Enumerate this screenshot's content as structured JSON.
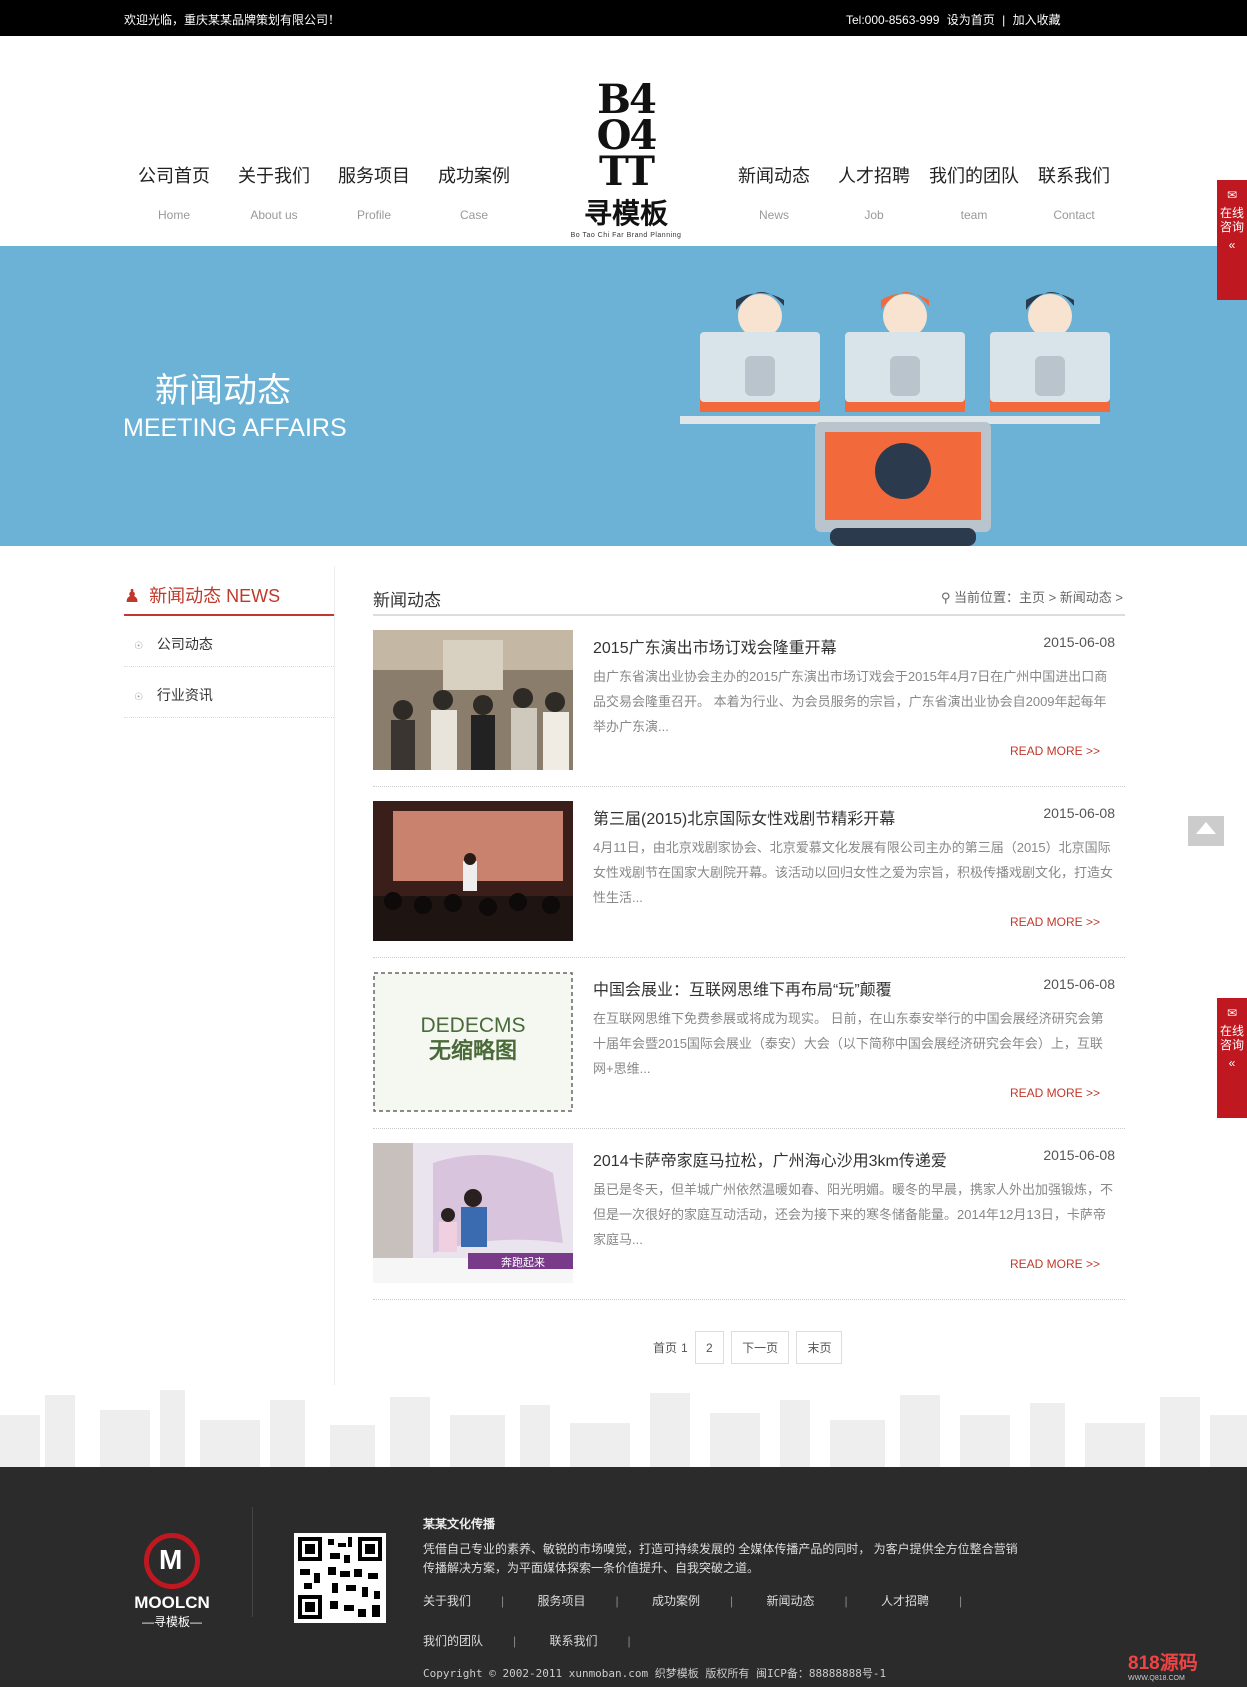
{
  "topbar": {
    "welcome": "欢迎光临，重庆某某品牌策划有限公司！",
    "tel": "Tel:000-8563-999",
    "set_home": "设为首页",
    "divider": "|",
    "favorite": "加入收藏"
  },
  "nav_left": [
    {
      "cn": "公司首页",
      "en": "Home"
    },
    {
      "cn": "关于我们",
      "en": "About us"
    },
    {
      "cn": "服务项目",
      "en": "Profile"
    },
    {
      "cn": "成功案例",
      "en": "Case"
    }
  ],
  "nav_right": [
    {
      "cn": "新闻动态",
      "en": "News"
    },
    {
      "cn": "人才招聘",
      "en": "Job"
    },
    {
      "cn": "我们的团队",
      "en": "team"
    },
    {
      "cn": "联系我们",
      "en": "Contact"
    }
  ],
  "logo": {
    "mark_line1": "B4",
    "mark_line2": "O4",
    "mark_line3": "TT",
    "name": "寻模板",
    "tagline": "Bo Tao Chi Far Brand Planning"
  },
  "banner": {
    "title_cn": "新闻动态",
    "title_en": "MEETING AFFAIRS",
    "bg_color": "#6bb2d6",
    "accent_color": "#f26a3b"
  },
  "side_float": {
    "label_top": "在线咨询",
    "label_bottom": "在线咨询",
    "arrow": "«"
  },
  "sidebar": {
    "title": "新闻动态 NEWS",
    "items": [
      "公司动态",
      "行业资讯"
    ]
  },
  "main": {
    "title": "新闻动态",
    "breadcrumb": "当前位置：主页 > 新闻动态 >"
  },
  "news": [
    {
      "title": "2015广东演出市场订戏会隆重开幕",
      "date": "2015-06-08",
      "desc": "由广东省演出业协会主办的2015广东演出市场订戏会于2015年4月7日在广州中国进出口商品交易会隆重召开。 本着为行业、为会员服务的宗旨，广东省演出业协会自2009年起每年举办广东演...",
      "more": "READ MORE >>"
    },
    {
      "title": "第三届(2015)北京国际女性戏剧节精彩开幕",
      "date": "2015-06-08",
      "desc": "4月11日，由北京戏剧家协会、北京爱慕文化发展有限公司主办的第三届（2015）北京国际女性戏剧节在国家大剧院开幕。该活动以回归女性之爱为宗旨，积极传播戏剧文化，打造女性生活...",
      "more": "READ MORE >>"
    },
    {
      "title": "中国会展业：互联网思维下再布局“玩”颠覆",
      "date": "2015-06-08",
      "desc": "在互联网思维下免费参展或将成为现实。 日前，在山东泰安举行的中国会展经济研究会第十届年会暨2015国际会展业（泰安）大会（以下简称中国会展经济研究会年会）上，互联网+思维...",
      "more": "READ MORE >>",
      "placeholder_line1": "DEDECMS",
      "placeholder_line2": "无缩略图"
    },
    {
      "title": "2014卡萨帝家庭马拉松，广州海心沙用3km传递爱",
      "date": "2015-06-08",
      "desc": "虽已是冬天，但羊城广州依然温暖如春、阳光明媚。暖冬的早晨，携家人外出加强锻炼，不但是一次很好的家庭互动活动，还会为接下来的寒冬储备能量。2014年12月13日，卡萨帝家庭马...",
      "more": "READ MORE >>",
      "photo_text": "奔跑起来"
    }
  ],
  "pager": {
    "first": "首页",
    "current": "1",
    "page2": "2",
    "next": "下一页",
    "last": "末页"
  },
  "footer": {
    "company": "某某文化传播",
    "intro": "凭借自己专业的素养、敏锐的市场嗅觉，打造可持续发展的 全媒体传播产品的同时， 为客户提供全方位整合营销传播解决方案，为平面媒体探索一条价值提升、自我突破之道。",
    "links1": [
      "关于我们",
      "服务项目",
      "成功案例",
      "新闻动态",
      "人才招聘"
    ],
    "links2": [
      "我们的团队",
      "联系我们"
    ],
    "copyright": "Copyright © 2002-2011 xunmoban.com 织梦模板 版权所有 闽ICP备：88888888号-1",
    "brand": "MOOLCN",
    "brand_cn": "—寻模板—",
    "sep": "|"
  },
  "watermark": {
    "name": "818源码",
    "url": "WWW.Q818.COM"
  }
}
